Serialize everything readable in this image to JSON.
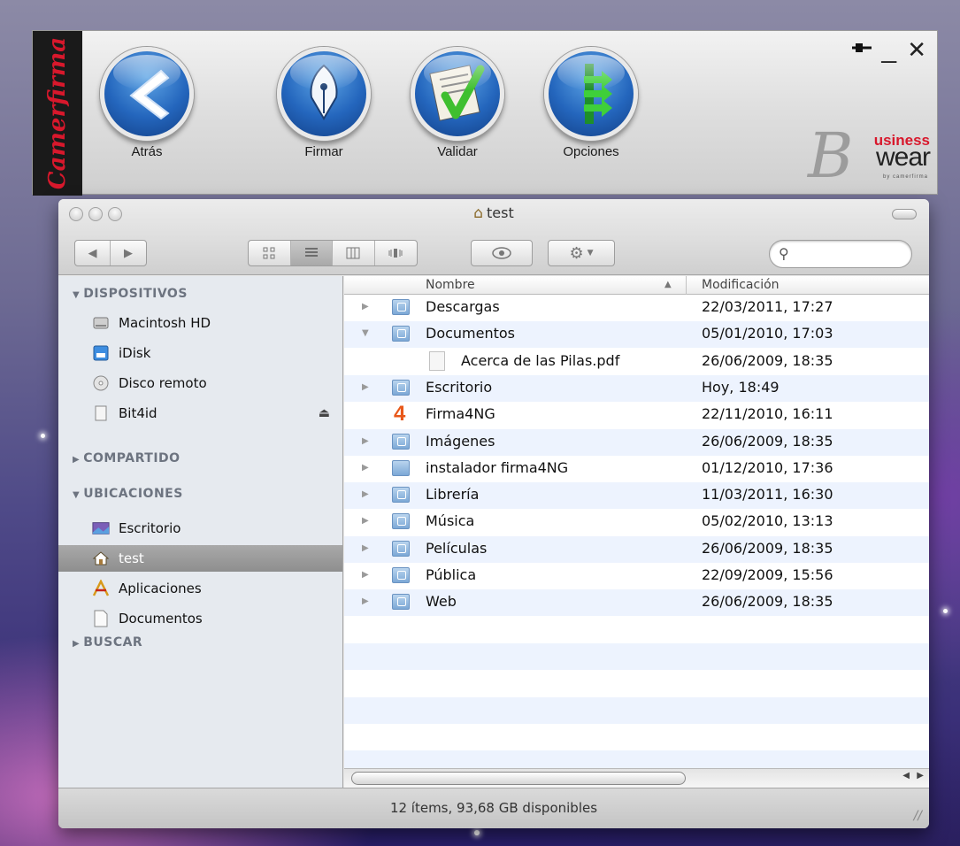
{
  "camerfirma": {
    "logo_text": "Camerfirma",
    "buttons": [
      {
        "label": "Atrás",
        "icon": "back-arrow-icon"
      },
      {
        "label": "Firmar",
        "icon": "fountain-pen-icon"
      },
      {
        "label": "Validar",
        "icon": "checkmark-document-icon"
      },
      {
        "label": "Opciones",
        "icon": "options-arrows-icon"
      }
    ],
    "controls": {
      "pin": "pin-icon",
      "minimize": "_",
      "close": "✕"
    },
    "brand": {
      "b": "B",
      "usiness": "usiness",
      "wear": "wear",
      "sub": "by camerfirma"
    }
  },
  "finder": {
    "title": "test",
    "search": {
      "placeholder": "",
      "value": ""
    },
    "sidebar": {
      "sections": {
        "devices": "DISPOSITIVOS",
        "shared": "COMPARTIDO",
        "places": "UBICACIONES",
        "search": "BUSCAR"
      },
      "devices": [
        {
          "label": "Macintosh HD",
          "icon": "hard-drive-icon"
        },
        {
          "label": "iDisk",
          "icon": "idisk-icon"
        },
        {
          "label": "Disco remoto",
          "icon": "remote-disc-icon"
        },
        {
          "label": "Bit4id",
          "icon": "usb-drive-icon"
        }
      ],
      "places": [
        {
          "label": "Escritorio",
          "icon": "desktop-icon"
        },
        {
          "label": "test",
          "icon": "home-icon",
          "selected": true
        },
        {
          "label": "Aplicaciones",
          "icon": "applications-icon"
        },
        {
          "label": "Documentos",
          "icon": "documents-icon"
        }
      ]
    },
    "columns": {
      "name": "Nombre",
      "date": "Modificación"
    },
    "files": [
      {
        "name": "Descargas",
        "date": "22/03/2011, 17:27",
        "kind": "folder",
        "expanded": false
      },
      {
        "name": "Documentos",
        "date": "05/01/2010, 17:03",
        "kind": "folder",
        "expanded": true
      },
      {
        "name": "Acerca de las Pilas.pdf",
        "date": "26/06/2009, 18:35",
        "kind": "pdf",
        "child": true
      },
      {
        "name": "Escritorio",
        "date": "Hoy, 18:49",
        "kind": "folder",
        "expanded": false
      },
      {
        "name": "Firma4NG",
        "date": "22/11/2010, 16:11",
        "kind": "app",
        "app_glyph": "4"
      },
      {
        "name": "Imágenes",
        "date": "26/06/2009, 18:35",
        "kind": "folder",
        "expanded": false
      },
      {
        "name": "instalador firma4NG",
        "date": "01/12/2010, 17:36",
        "kind": "folder-plain",
        "expanded": false
      },
      {
        "name": "Librería",
        "date": "11/03/2011, 16:30",
        "kind": "folder",
        "expanded": false
      },
      {
        "name": "Música",
        "date": "05/02/2010, 13:13",
        "kind": "folder",
        "expanded": false
      },
      {
        "name": "Películas",
        "date": "26/06/2009, 18:35",
        "kind": "folder",
        "expanded": false
      },
      {
        "name": "Pública",
        "date": "22/09/2009, 15:56",
        "kind": "folder",
        "expanded": false
      },
      {
        "name": "Web",
        "date": "26/06/2009, 18:35",
        "kind": "folder",
        "expanded": false
      }
    ],
    "status": "12 ítems, 93,68 GB disponibles"
  }
}
